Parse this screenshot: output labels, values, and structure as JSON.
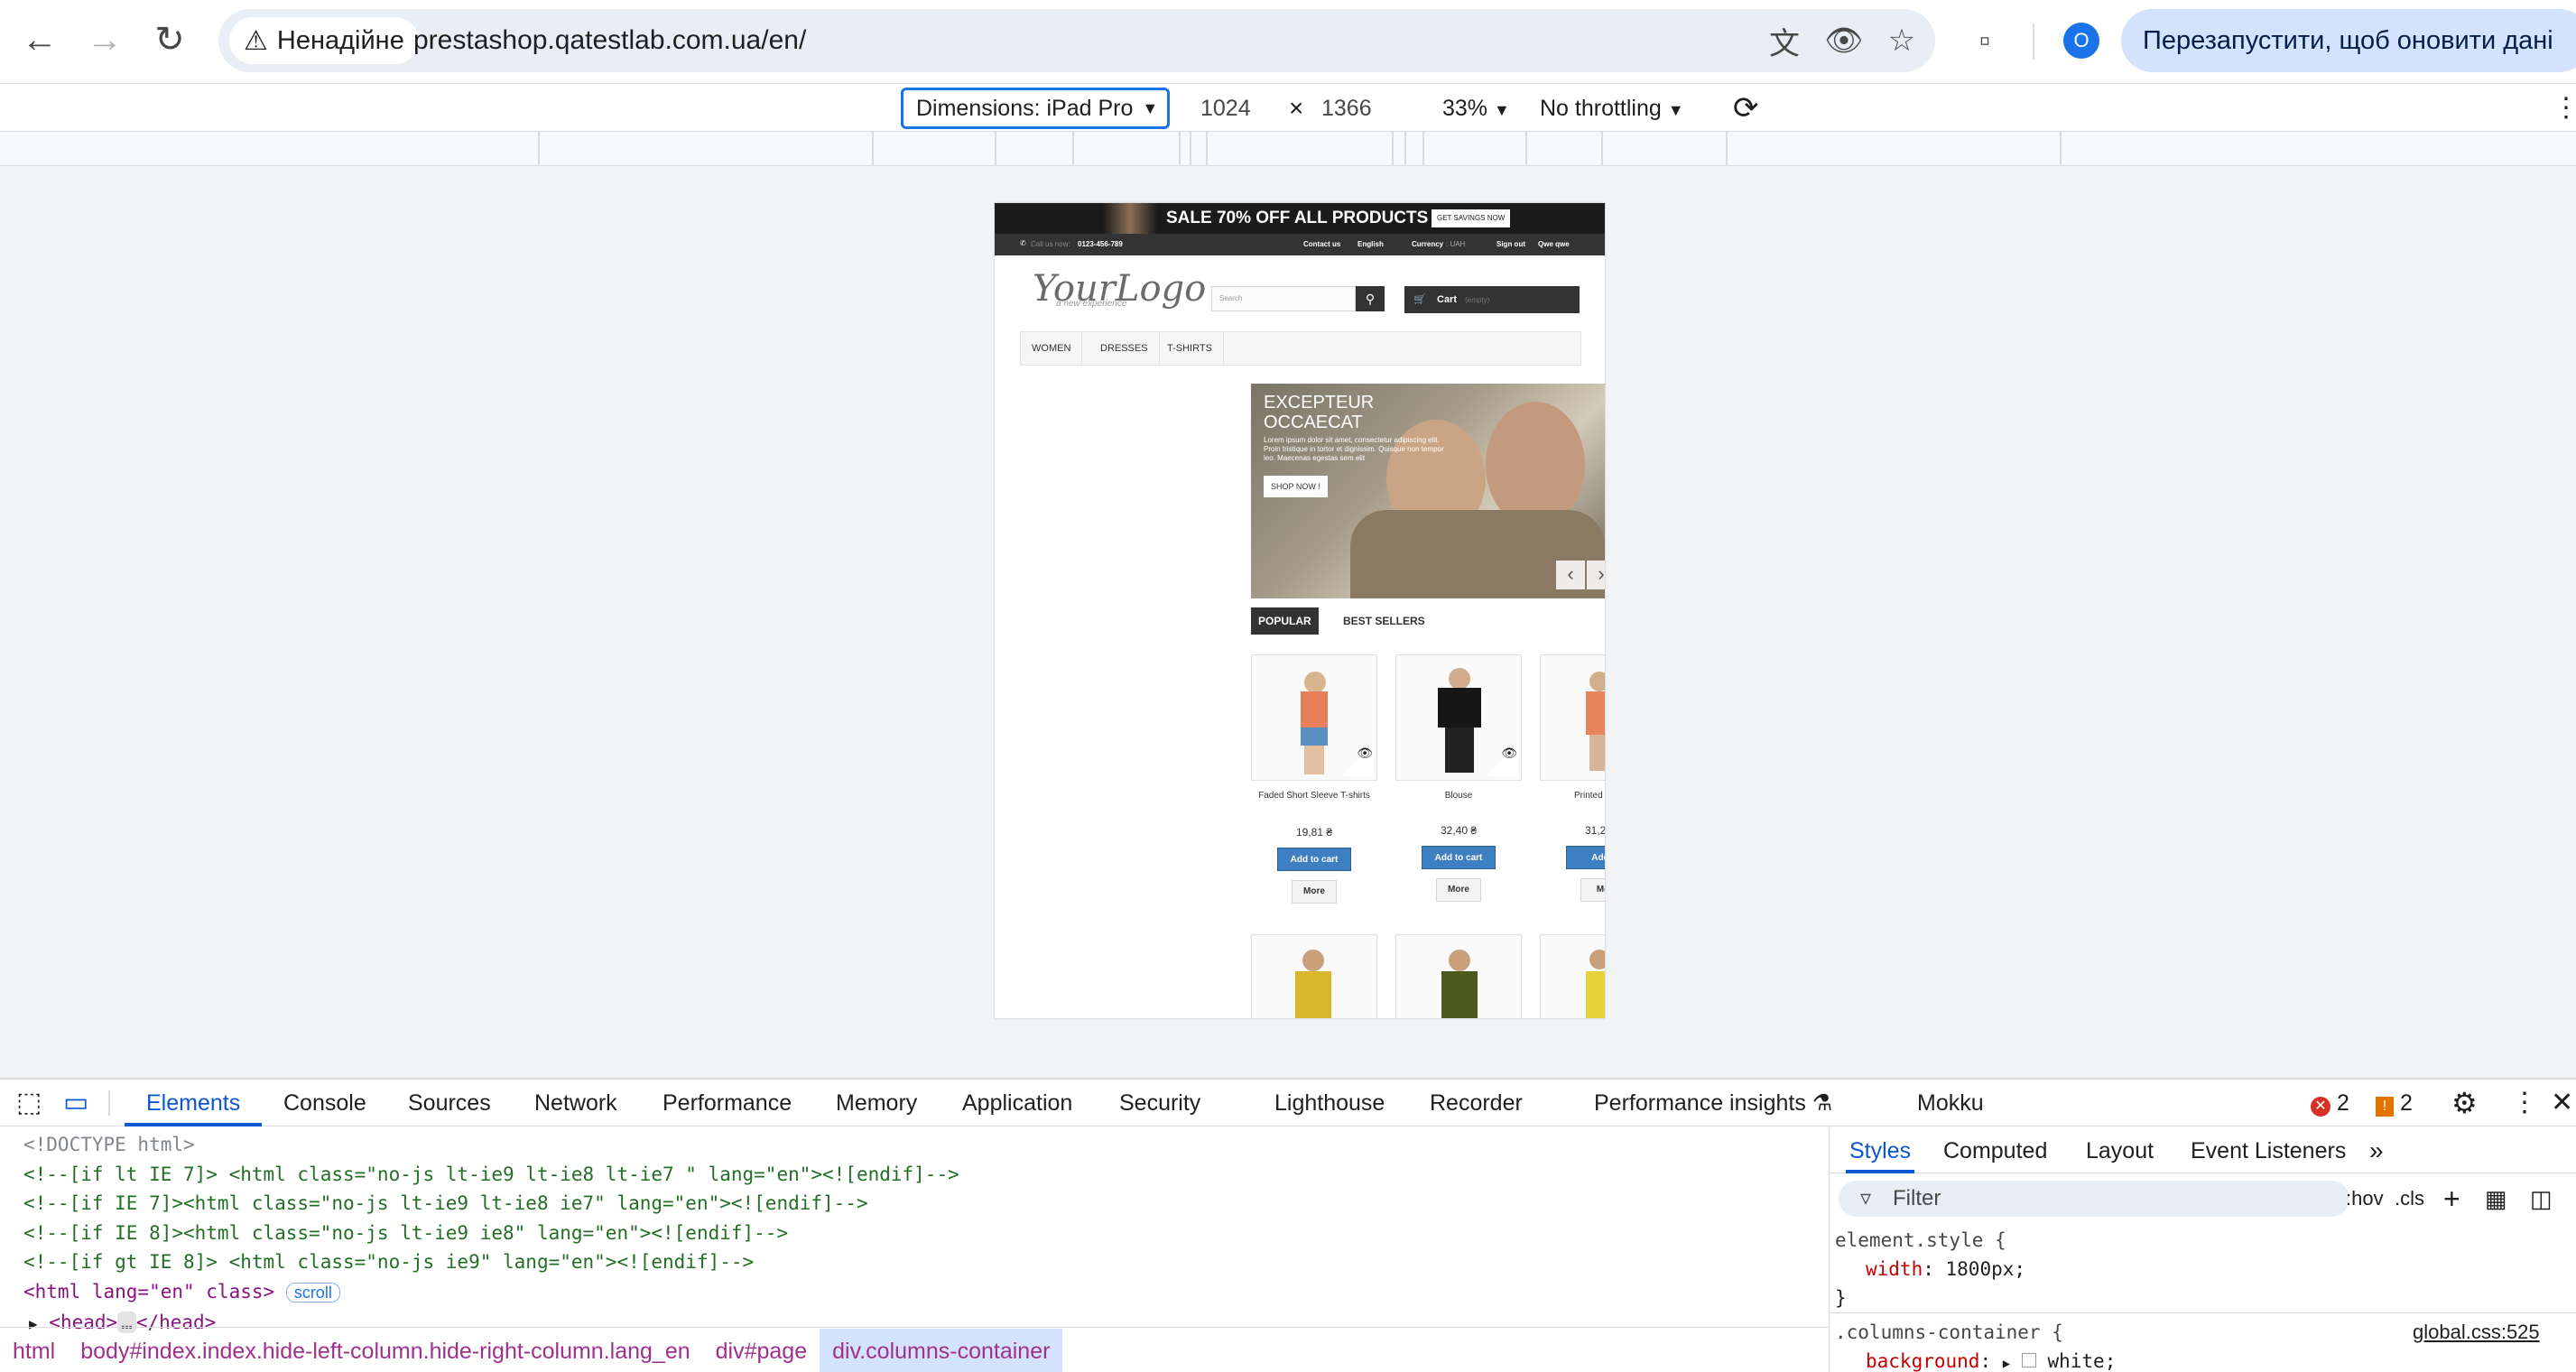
{
  "browser": {
    "security_label": "Ненадійне",
    "url": "prestashop.qatestlab.com.ua/en/",
    "relaunch_label": "Перезапустити, щоб оновити дані",
    "profile_initial": "O"
  },
  "device_toolbar": {
    "dimensions_label": "Dimensions: iPad Pro",
    "width": "1024",
    "times": "×",
    "height": "1366",
    "zoom": "33%",
    "throttling": "No throttling"
  },
  "site": {
    "promo": "SALE 70% OFF ALL PRODUCTS",
    "promo_button": "GET SAVINGS NOW",
    "call_us": "Call us now:",
    "phone": "0123-456-789",
    "contact": "Contact us",
    "language": "English",
    "currency": "Currency",
    "currency_value": ": UAH",
    "sign_out": "Sign out",
    "user": "Qwe qwe",
    "logo": "YourLogo",
    "logo_sub": "a new experience",
    "search_placeholder": "Search",
    "cart": "Cart",
    "cart_empty": "(empty)",
    "menu": [
      "WOMEN",
      "DRESSES",
      "T-SHIRTS"
    ],
    "slide_title": "EXCEPTEUR OCCAECAT",
    "slide_text": "Lorem ipsum dolor sit amet, consectetur adipiscing elit. Proin tristique in tortor et dignissim. Quisque non tempor leo. Maecenas egestas sem elit",
    "slide_button": "SHOP NOW !",
    "tab_popular": "POPULAR",
    "tab_bestsellers": "BEST SELLERS",
    "products": [
      {
        "name": "Faded Short Sleeve T-shirts",
        "price": "19,81 ₴",
        "add": "Add to cart",
        "more": "More"
      },
      {
        "name": "Blouse",
        "price": "32,40 ₴",
        "add": "Add to cart",
        "more": "More"
      },
      {
        "name": "Printed",
        "price": "31,2",
        "add": "Add t",
        "more": "Mo"
      }
    ]
  },
  "devtools": {
    "tabs": [
      "Elements",
      "Console",
      "Sources",
      "Network",
      "Performance",
      "Memory",
      "Application",
      "Security",
      "Lighthouse",
      "Recorder",
      "Performance insights",
      "Mokku"
    ],
    "error_count": "2",
    "warning_count": "2",
    "dom_lines": [
      "<!DOCTYPE html>",
      "<!--[if lt IE 7]> <html class=\"no-js lt-ie9 lt-ie8 lt-ie7 \" lang=\"en\"><![endif]-->",
      "<!--[if IE 7]><html class=\"no-js lt-ie9 lt-ie8 ie7\" lang=\"en\"><![endif]-->",
      "<!--[if IE 8]><html class=\"no-js lt-ie9 ie8\" lang=\"en\"><![endif]-->",
      "<!--[if gt IE 8]> <html class=\"no-js ie9\" lang=\"en\"><![endif]-->"
    ],
    "html_open": "<html lang=\"en\" class>",
    "scroll_badge": "scroll",
    "head_line": "<head>",
    "head_close": "</head>",
    "ellipsis": "…",
    "breadcrumbs": [
      "html",
      "body#index.index.hide-left-column.hide-right-column.lang_en",
      "div#page",
      "div.columns-container"
    ],
    "styles_tabs": [
      "Styles",
      "Computed",
      "Layout",
      "Event Listeners"
    ],
    "filter_placeholder": "Filter",
    "hov": ":hov",
    "cls": ".cls",
    "rule1_selector": "element.style {",
    "rule1_prop": "width",
    "rule1_val": "1800px;",
    "rule1_close": "}",
    "rule2_selector": ".columns-container {",
    "rule2_source": "global.css:525",
    "rule2_prop": "background",
    "rule2_val": "white;"
  }
}
